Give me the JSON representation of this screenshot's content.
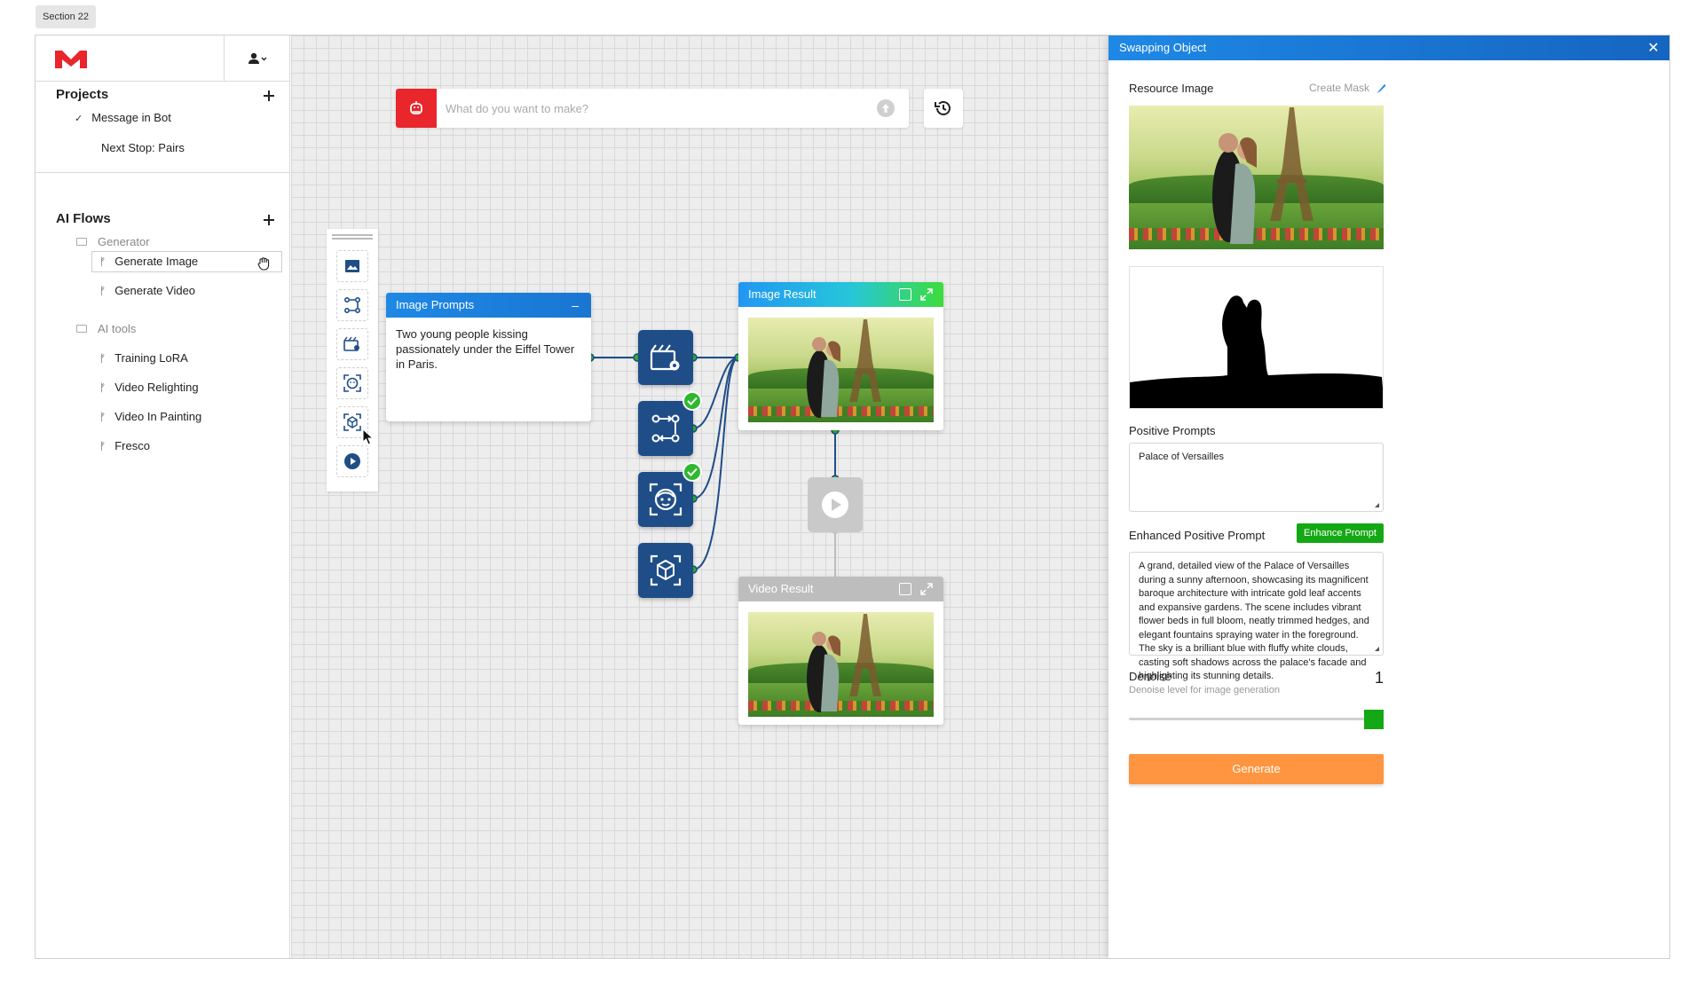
{
  "section_tag": "Section 22",
  "colors": {
    "brand": "#e8262c",
    "node_blue": "#1f4d87",
    "accent_blue": "#1e88e5",
    "success": "#14a814",
    "generate": "#ff9540"
  },
  "sidebar": {
    "projects_title": "Projects",
    "projects": [
      {
        "label": "Message in Bot",
        "checked": true
      },
      {
        "label": "Next Stop: Pairs",
        "checked": false
      }
    ],
    "flows_title": "AI Flows",
    "flow_groups": [
      {
        "folder": "Generator",
        "items": [
          "Generate Image",
          "Generate Video"
        ]
      },
      {
        "folder": "AI tools",
        "items": [
          "Training LoRA",
          "Video Relighting",
          "Video In Painting",
          "Fresco"
        ]
      }
    ]
  },
  "prompt_bar": {
    "placeholder": "What do you want to make?"
  },
  "palette": {
    "tools": [
      "image-icon",
      "flow-swap-icon",
      "video-settings-icon",
      "face-icon",
      "object-icon",
      "play-icon"
    ]
  },
  "nodes": {
    "image_prompts": {
      "title": "Image Prompts",
      "collapse": "–",
      "text": "Two young people kissing passionately under the Eiffel Tower in Paris."
    },
    "image_result": {
      "title": "Image Result"
    },
    "video_result": {
      "title": "Video Result"
    }
  },
  "panel": {
    "title": "Swapping  Object",
    "close": "✕",
    "resource_label": "Resource Image",
    "create_mask": "Create Mask",
    "positive_label": "Positive Prompts",
    "positive_value": "Palace of Versailles",
    "enhanced_label": "Enhanced Positive Prompt",
    "enhance_button": "Enhance Prompt",
    "enhanced_value": "A grand, detailed view of the Palace of Versailles during a sunny afternoon, showcasing its magnificent baroque architecture with intricate gold leaf accents and expansive gardens. The scene includes vibrant flower beds in full bloom, neatly trimmed hedges, and elegant fountains spraying water in the foreground. The sky is a brilliant blue with fluffy white clouds, casting soft shadows across the palace's facade and highlighting its stunning details.",
    "denoise_label": "Denoise",
    "denoise_desc": "Denoise level for image generation",
    "denoise_value": "1",
    "denoise_fraction": 1,
    "generate_button": "Generate"
  }
}
